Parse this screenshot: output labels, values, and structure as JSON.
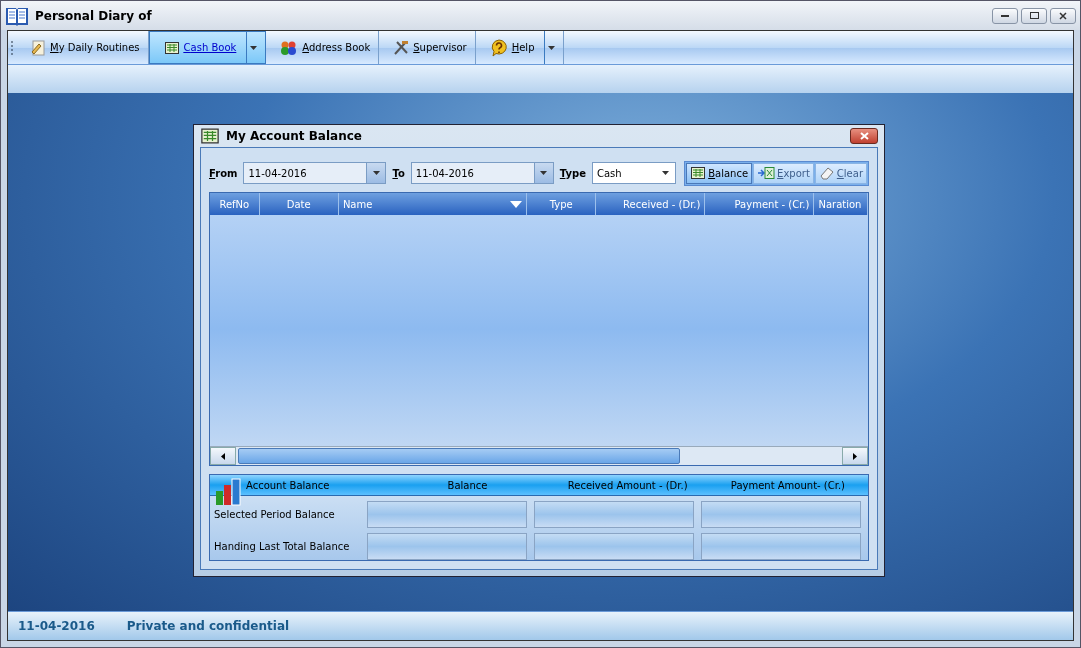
{
  "window": {
    "title": "Personal Diary of"
  },
  "menu": [
    {
      "label": "My Daily Routines",
      "selected": false,
      "dropdown": false
    },
    {
      "label": "Cash Book",
      "selected": true,
      "dropdown": true
    },
    {
      "label": "Address Book",
      "selected": false,
      "dropdown": false
    },
    {
      "label": "Supervisor",
      "selected": false,
      "dropdown": false
    },
    {
      "label": "Help",
      "selected": false,
      "dropdown": true
    }
  ],
  "dialog": {
    "title": "My Account Balance",
    "filters": {
      "from_label": "From",
      "from_value": "11-04-2016",
      "to_label": "To",
      "to_value": "11-04-2016",
      "type_label": "Type",
      "type_value": "Cash"
    },
    "buttons": [
      {
        "label": "Balance",
        "disabled": false
      },
      {
        "label": "Export",
        "disabled": true
      },
      {
        "label": "Clear",
        "disabled": true
      }
    ],
    "table": {
      "columns": [
        {
          "label": "RefNo",
          "sort": false
        },
        {
          "label": "Date",
          "sort": false
        },
        {
          "label": "Name",
          "sort": true
        },
        {
          "label": "Type",
          "sort": false
        },
        {
          "label": "Received - (Dr.)",
          "sort": false
        },
        {
          "label": "Payment - (Cr.)",
          "sort": false
        },
        {
          "label": "Naration",
          "sort": false
        }
      ]
    },
    "summary": {
      "columns": [
        "Account Balance",
        "Balance",
        "Received Amount - (Dr.)",
        "Payment Amount- (Cr.)"
      ],
      "rows": [
        "Selected Period Balance",
        "Handing Last Total Balance"
      ]
    }
  },
  "status_bar": {
    "date": "11-04-2016",
    "note": "Private and confidential"
  }
}
